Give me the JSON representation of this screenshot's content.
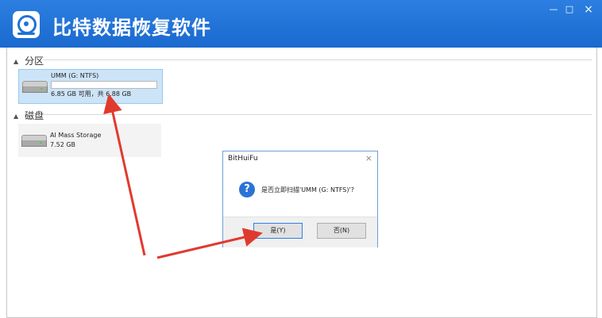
{
  "app": {
    "title": "比特数据恢复软件"
  },
  "window_controls": {
    "minimize": "—",
    "maximize": "□",
    "close": "×"
  },
  "partitions": {
    "header": "分区",
    "items": [
      {
        "name": "UMM (G: NTFS)",
        "size": "6.85 GB 可用，共 6.88 GB",
        "selected": true
      }
    ]
  },
  "disks": {
    "header": "磁盘",
    "items": [
      {
        "name": "AI Mass Storage",
        "size": "7.52 GB"
      }
    ]
  },
  "dialog": {
    "title": "BitHuiFu",
    "close": "×",
    "icon": "?",
    "message": "是否立即扫描'UMM (G: NTFS)'?",
    "yes": "是(Y)",
    "no": "否(N)"
  },
  "annotation": {
    "arrow_color": "#e03a2e"
  },
  "colors": {
    "titlebar": "#1f72d8",
    "selection": "#cce4f7"
  }
}
